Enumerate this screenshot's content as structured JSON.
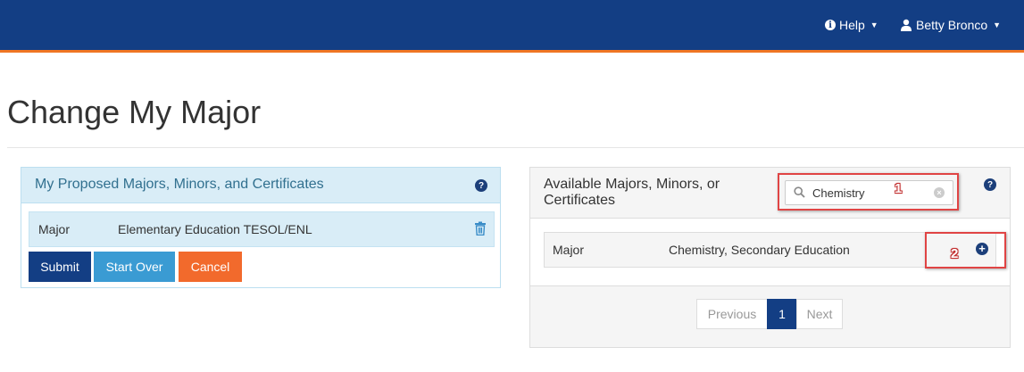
{
  "header": {
    "help_label": "Help",
    "user_name": "Betty Bronco",
    "colors": {
      "bar": "#133e84",
      "accent": "#f07623"
    }
  },
  "page": {
    "title": "Change My Major"
  },
  "proposed_panel": {
    "title": "My Proposed Majors, Minors, and Certificates",
    "rows": [
      {
        "type": "Major",
        "name": "Elementary Education TESOL/ENL"
      }
    ],
    "buttons": {
      "submit": "Submit",
      "start_over": "Start Over",
      "cancel": "Cancel"
    }
  },
  "available_panel": {
    "title": "Available Majors, Minors, or Certificates",
    "search": {
      "value": "Chemistry",
      "placeholder": ""
    },
    "results": [
      {
        "type": "Major",
        "name": "Chemistry, Secondary Education"
      }
    ],
    "pagination": {
      "previous": "Previous",
      "current": "1",
      "next": "Next"
    }
  },
  "annotations": {
    "step1": "1",
    "step2": "2"
  }
}
